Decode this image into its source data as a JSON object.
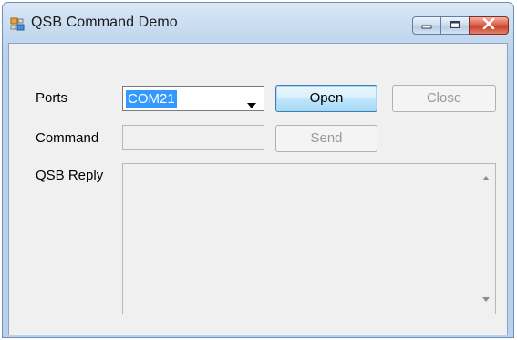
{
  "window": {
    "title": "QSB Command Demo"
  },
  "form": {
    "ports_label": "Ports",
    "ports_value": "COM21",
    "open_label": "Open",
    "close_label": "Close",
    "command_label": "Command",
    "command_value": "",
    "send_label": "Send",
    "reply_label": "QSB Reply",
    "reply_text": ""
  },
  "colors": {
    "selection": "#3399ff",
    "title_bar": "#c8dbf0",
    "close_button": "#d9553f"
  },
  "icons": [
    "app-icon",
    "minimize-icon",
    "maximize-icon",
    "close-icon",
    "dropdown-arrow-icon",
    "scroll-up-icon",
    "scroll-down-icon"
  ]
}
